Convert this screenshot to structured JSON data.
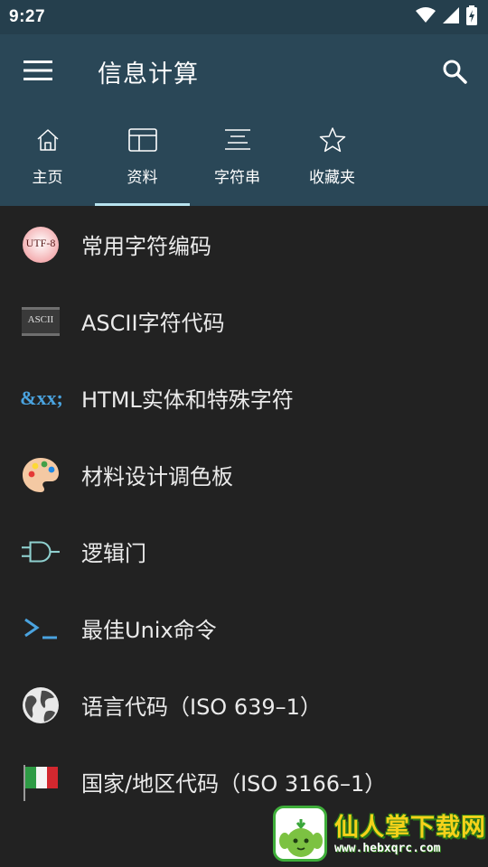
{
  "status_bar": {
    "time": "9:27",
    "icons": [
      "wifi-icon",
      "signal-icon",
      "battery-charging-icon"
    ]
  },
  "app_bar": {
    "title": "信息计算",
    "menu_icon": "hamburger-menu-icon",
    "search_icon": "search-icon"
  },
  "tabs": [
    {
      "label": "主页",
      "icon": "home-icon",
      "active": false
    },
    {
      "label": "资料",
      "icon": "table-icon",
      "active": true
    },
    {
      "label": "字符串",
      "icon": "text-lines-icon",
      "active": false
    },
    {
      "label": "收藏夹",
      "icon": "star-icon",
      "active": false
    }
  ],
  "list": [
    {
      "label": "常用字符编码",
      "icon": "utf8-icon",
      "icon_text": "UTF-8"
    },
    {
      "label": "ASCII字符代码",
      "icon": "ascii-icon",
      "icon_text": "ASCII"
    },
    {
      "label": "HTML实体和特殊字符",
      "icon": "html-entity-icon",
      "icon_text": "&xx;"
    },
    {
      "label": "材料设计调色板",
      "icon": "palette-icon"
    },
    {
      "label": "逻辑门",
      "icon": "logic-gate-icon"
    },
    {
      "label": "最佳Unix命令",
      "icon": "terminal-icon"
    },
    {
      "label": "语言代码（ISO 639–1）",
      "icon": "globe-icon"
    },
    {
      "label": "国家/地区代码（ISO 3166–1）",
      "icon": "italy-flag-icon"
    }
  ],
  "watermark": {
    "title": "仙人掌下载网",
    "url": "www.hebxqrc.com"
  },
  "colors": {
    "app_bar": "#2a4757",
    "status_bar": "#253f4d",
    "background": "#222222",
    "tab_indicator": "#b7e3ef",
    "accent_blue": "#4aa3df"
  }
}
